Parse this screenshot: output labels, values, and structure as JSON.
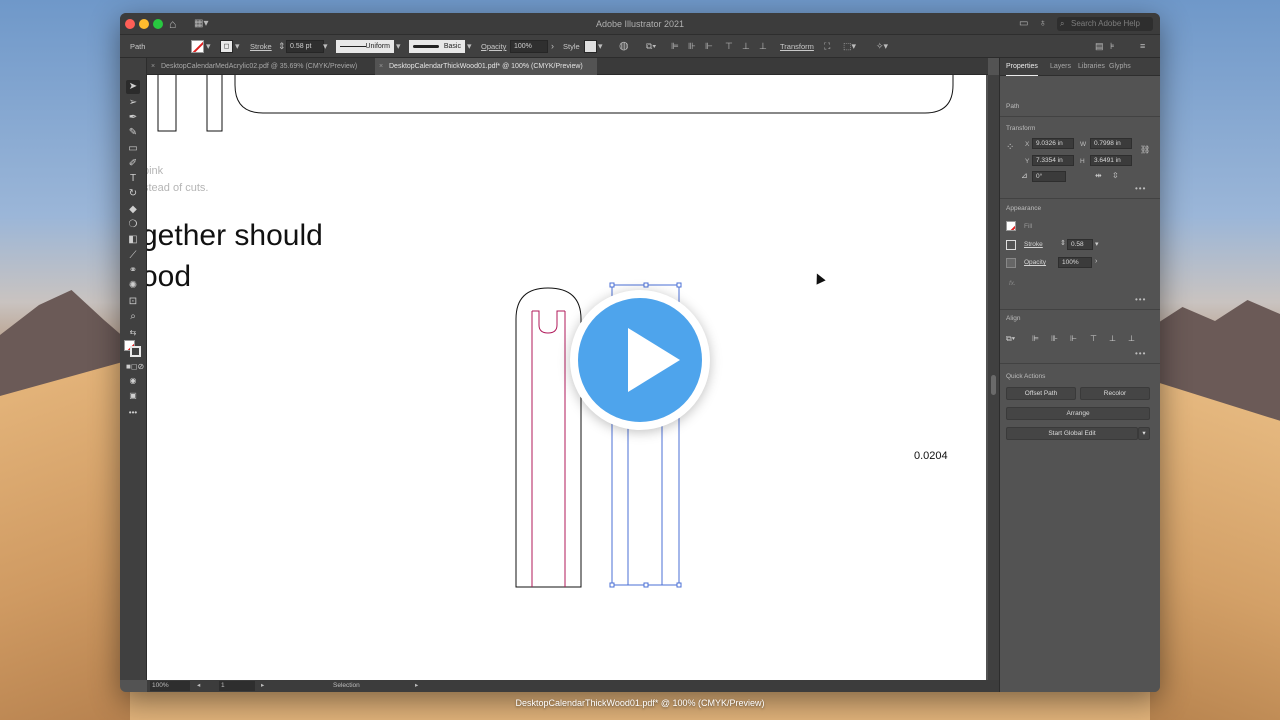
{
  "app": {
    "title": "Adobe Illustrator 2021",
    "search_placeholder": "Search Adobe Help"
  },
  "control_bar": {
    "selection_type": "Path",
    "stroke_label": "Stroke",
    "stroke_weight": "0.58 pt",
    "stroke_profile": "Uniform",
    "brush": "Basic",
    "opacity_label": "Opacity",
    "opacity_value": "100%",
    "style_label": "Style",
    "transform_label": "Transform"
  },
  "tabs": [
    {
      "label": "DesktopCalendarMedAcrylic02.pdf @ 35.69% (CMYK/Preview)",
      "active": false
    },
    {
      "label": "DesktopCalendarThickWood01.pdf* @ 100% (CMYK/Preview)",
      "active": true
    }
  ],
  "artboard": {
    "grey_line_1": "pink",
    "grey_line_2": "stead of cuts.",
    "big_line_1": "gether should",
    "big_line_2": "ood",
    "dimension_label": "0.0204"
  },
  "status_bar": {
    "zoom": "100%",
    "artboard_number": "1",
    "tool": "Selection"
  },
  "panel": {
    "tabs": [
      "Properties",
      "Layers",
      "Libraries",
      "Glyphs"
    ],
    "selection": "Path",
    "transform": {
      "title": "Transform",
      "x_label": "X",
      "x": "9.0326 in",
      "y_label": "Y",
      "y": "7.3354 in",
      "w_label": "W",
      "w": "0.7998 in",
      "h_label": "H",
      "h": "3.6491 in",
      "angle": "0°"
    },
    "appearance": {
      "title": "Appearance",
      "fill_label": "Fill",
      "stroke_label": "Stroke",
      "stroke_value": "0.58",
      "opacity_label": "Opacity",
      "opacity_value": "100%",
      "fx": "fx."
    },
    "align": {
      "title": "Align"
    },
    "quick_actions": {
      "title": "Quick Actions",
      "offset_path": "Offset Path",
      "recolor": "Recolor",
      "arrange": "Arrange",
      "global_edit": "Start Global Edit"
    }
  },
  "caption": "DesktopCalendarThickWood01.pdf* @ 100% (CMYK/Preview)",
  "colors": {
    "accent_play": "#4ea4ec",
    "cut_line_red": "#b0185a",
    "selection_blue": "#4a6fd6"
  }
}
